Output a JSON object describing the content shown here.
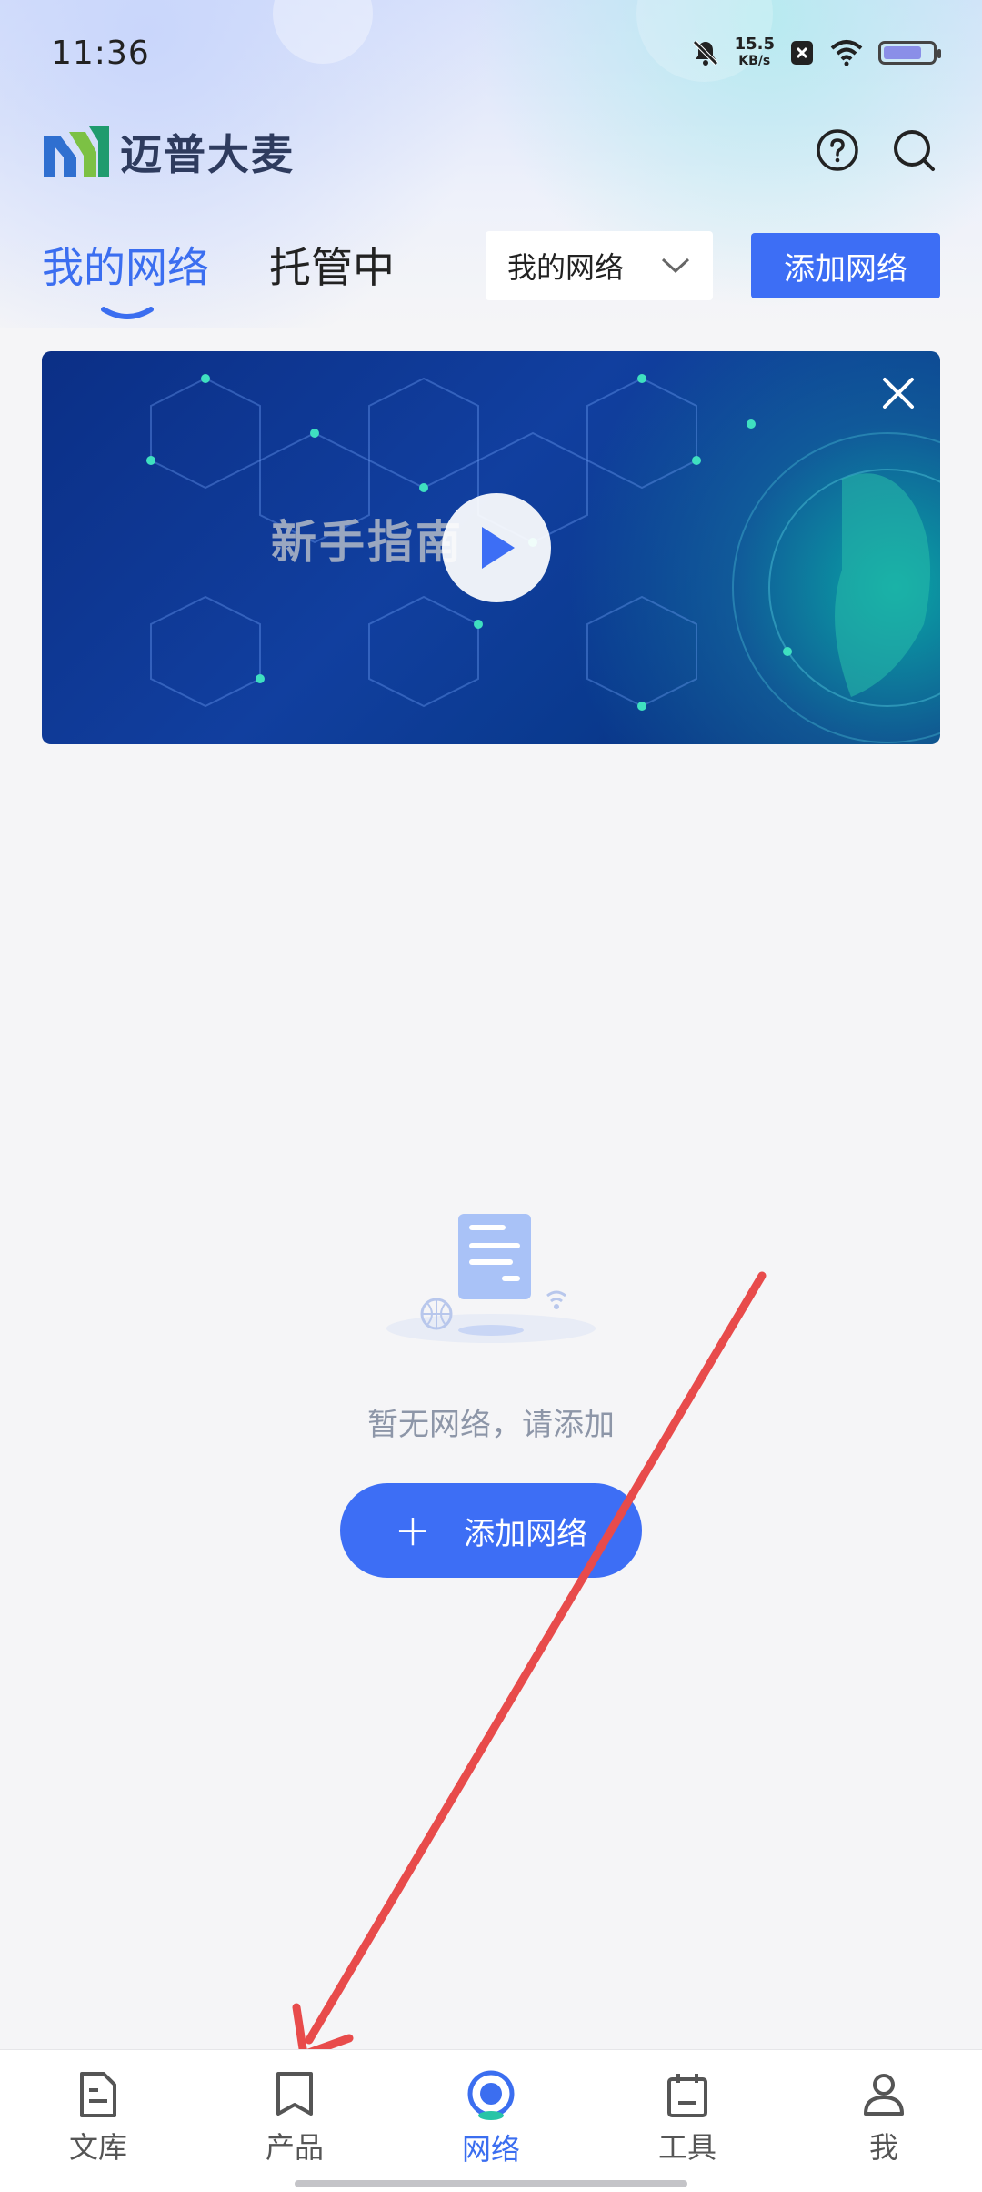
{
  "status_bar": {
    "time": "11:36",
    "net_speed_value": "15.5",
    "net_speed_unit": "KB/s"
  },
  "header": {
    "app_name": "迈普大麦",
    "help_icon": "question-circle-icon",
    "search_icon": "search-icon"
  },
  "tabs": [
    {
      "label": "我的网络",
      "active": true
    },
    {
      "label": "托管中",
      "active": false
    }
  ],
  "network_selector": {
    "value": "我的网络"
  },
  "add_network_top_label": "添加网络",
  "banner": {
    "title": "新手指南",
    "play_icon": "play-icon",
    "close_icon": "close-icon"
  },
  "empty_state": {
    "message": "暂无网络，请添加",
    "button_icon": "+",
    "button_label": "添加网络"
  },
  "bottom_nav": [
    {
      "label": "文库",
      "icon": "document-icon",
      "active": false
    },
    {
      "label": "产品",
      "icon": "bookmark-icon",
      "active": false
    },
    {
      "label": "网络",
      "icon": "network-icon",
      "active": true
    },
    {
      "label": "工具",
      "icon": "calendar-icon",
      "active": false
    },
    {
      "label": "我",
      "icon": "user-icon",
      "active": false
    }
  ],
  "colors": {
    "accent": "#3d6ef5",
    "active_tab": "#3b6ef0",
    "annotation_arrow": "#e84b4b"
  }
}
